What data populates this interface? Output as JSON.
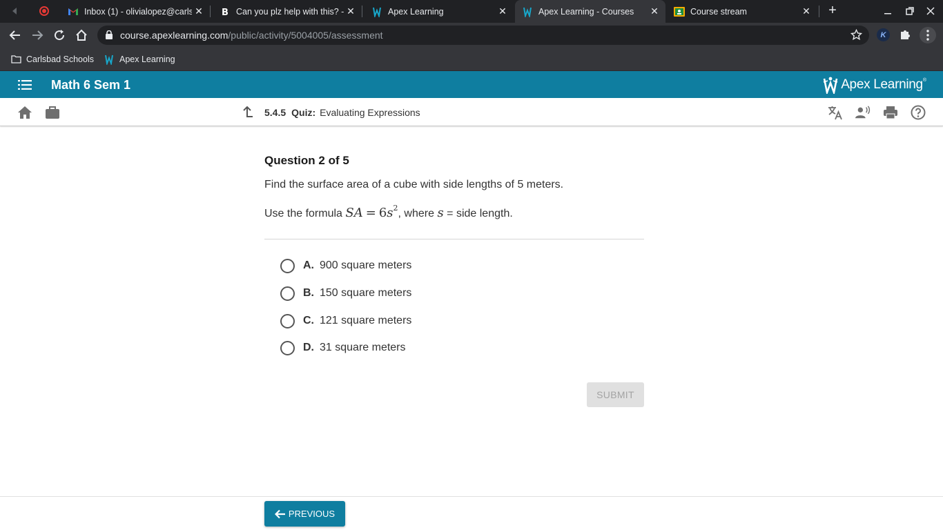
{
  "browser": {
    "tabs": [
      {
        "title": "Inbox (1) - olivialopez@carlsb",
        "favicon": "gmail-icon",
        "active": false
      },
      {
        "title": "Can you plz help with this? - B",
        "favicon": "brainly-icon",
        "active": false
      },
      {
        "title": "Apex Learning",
        "favicon": "apex-icon",
        "active": false
      },
      {
        "title": "Apex Learning - Courses",
        "favicon": "apex-icon",
        "active": true
      },
      {
        "title": "Course stream",
        "favicon": "classroom-icon",
        "active": false
      }
    ],
    "url_host": "course.apexlearning.com",
    "url_path": "/public/activity/5004005/assessment",
    "profile_initial": "K",
    "bookmarks": [
      {
        "label": "Carlsbad Schools",
        "icon": "folder-icon"
      },
      {
        "label": "Apex Learning",
        "icon": "apex-icon"
      }
    ]
  },
  "app": {
    "course_title": "Math 6 Sem 1",
    "logo_text": "Apex Learning",
    "brand_color": "#0f7ea0"
  },
  "breadcrumb": {
    "number": "5.4.5",
    "kind": "Quiz:",
    "title": "Evaluating Expressions"
  },
  "question": {
    "header": "Question 2 of 5",
    "text": "Find the surface area of a cube with side lengths of 5 meters.",
    "formula_prefix": "Use the formula",
    "formula_lhs": "SA",
    "formula_eq": "=",
    "formula_coef": "6",
    "formula_var": "s",
    "formula_exp": "2",
    "formula_mid": ", where",
    "formula_var2": "s",
    "formula_suffix": "= side length.",
    "choices": [
      {
        "letter": "A.",
        "text": "900 square meters"
      },
      {
        "letter": "B.",
        "text": "150 square meters"
      },
      {
        "letter": "C.",
        "text": "121 square meters"
      },
      {
        "letter": "D.",
        "text": "31 square meters"
      }
    ]
  },
  "buttons": {
    "submit": "SUBMIT",
    "previous": "PREVIOUS"
  }
}
